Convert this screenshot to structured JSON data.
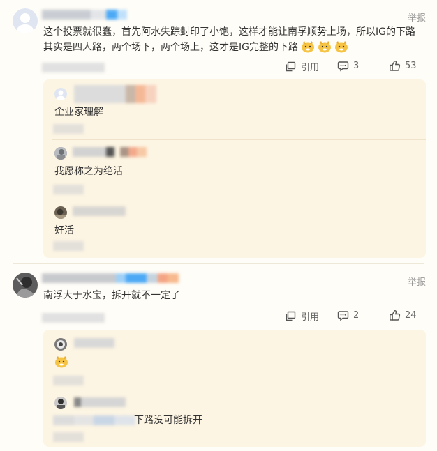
{
  "comments": [
    {
      "text": "这个投票就很蠢，首先阿水失踪封印了小饱，这样才能让南孚顺势上场，所以IG的下路其实是四人路，两个场下，两个场上，这才是IG完整的下路",
      "report_label": "举报",
      "quote_label": "引用",
      "reply_count": "3",
      "like_count": "53",
      "replies": [
        {
          "text": "企业家理解"
        },
        {
          "text": "我愿称之为绝活"
        },
        {
          "text": "好活"
        }
      ]
    },
    {
      "text": "南浮大于水宝，拆开就不一定了",
      "report_label": "举报",
      "quote_label": "引用",
      "reply_count": "2",
      "like_count": "24",
      "replies": [
        {
          "text": ""
        },
        {
          "text": "下路没可能拆开"
        }
      ]
    }
  ],
  "colors": {
    "accent_blue": "#4da9f5",
    "reply_bg": "#fdf5e3",
    "emoji_yellow": "#f6c445"
  },
  "icons": {
    "quote": "quote-icon",
    "comment": "comment-bubble-icon",
    "like": "thumbs-up-icon",
    "emoji": "doge-emoji-icon"
  }
}
